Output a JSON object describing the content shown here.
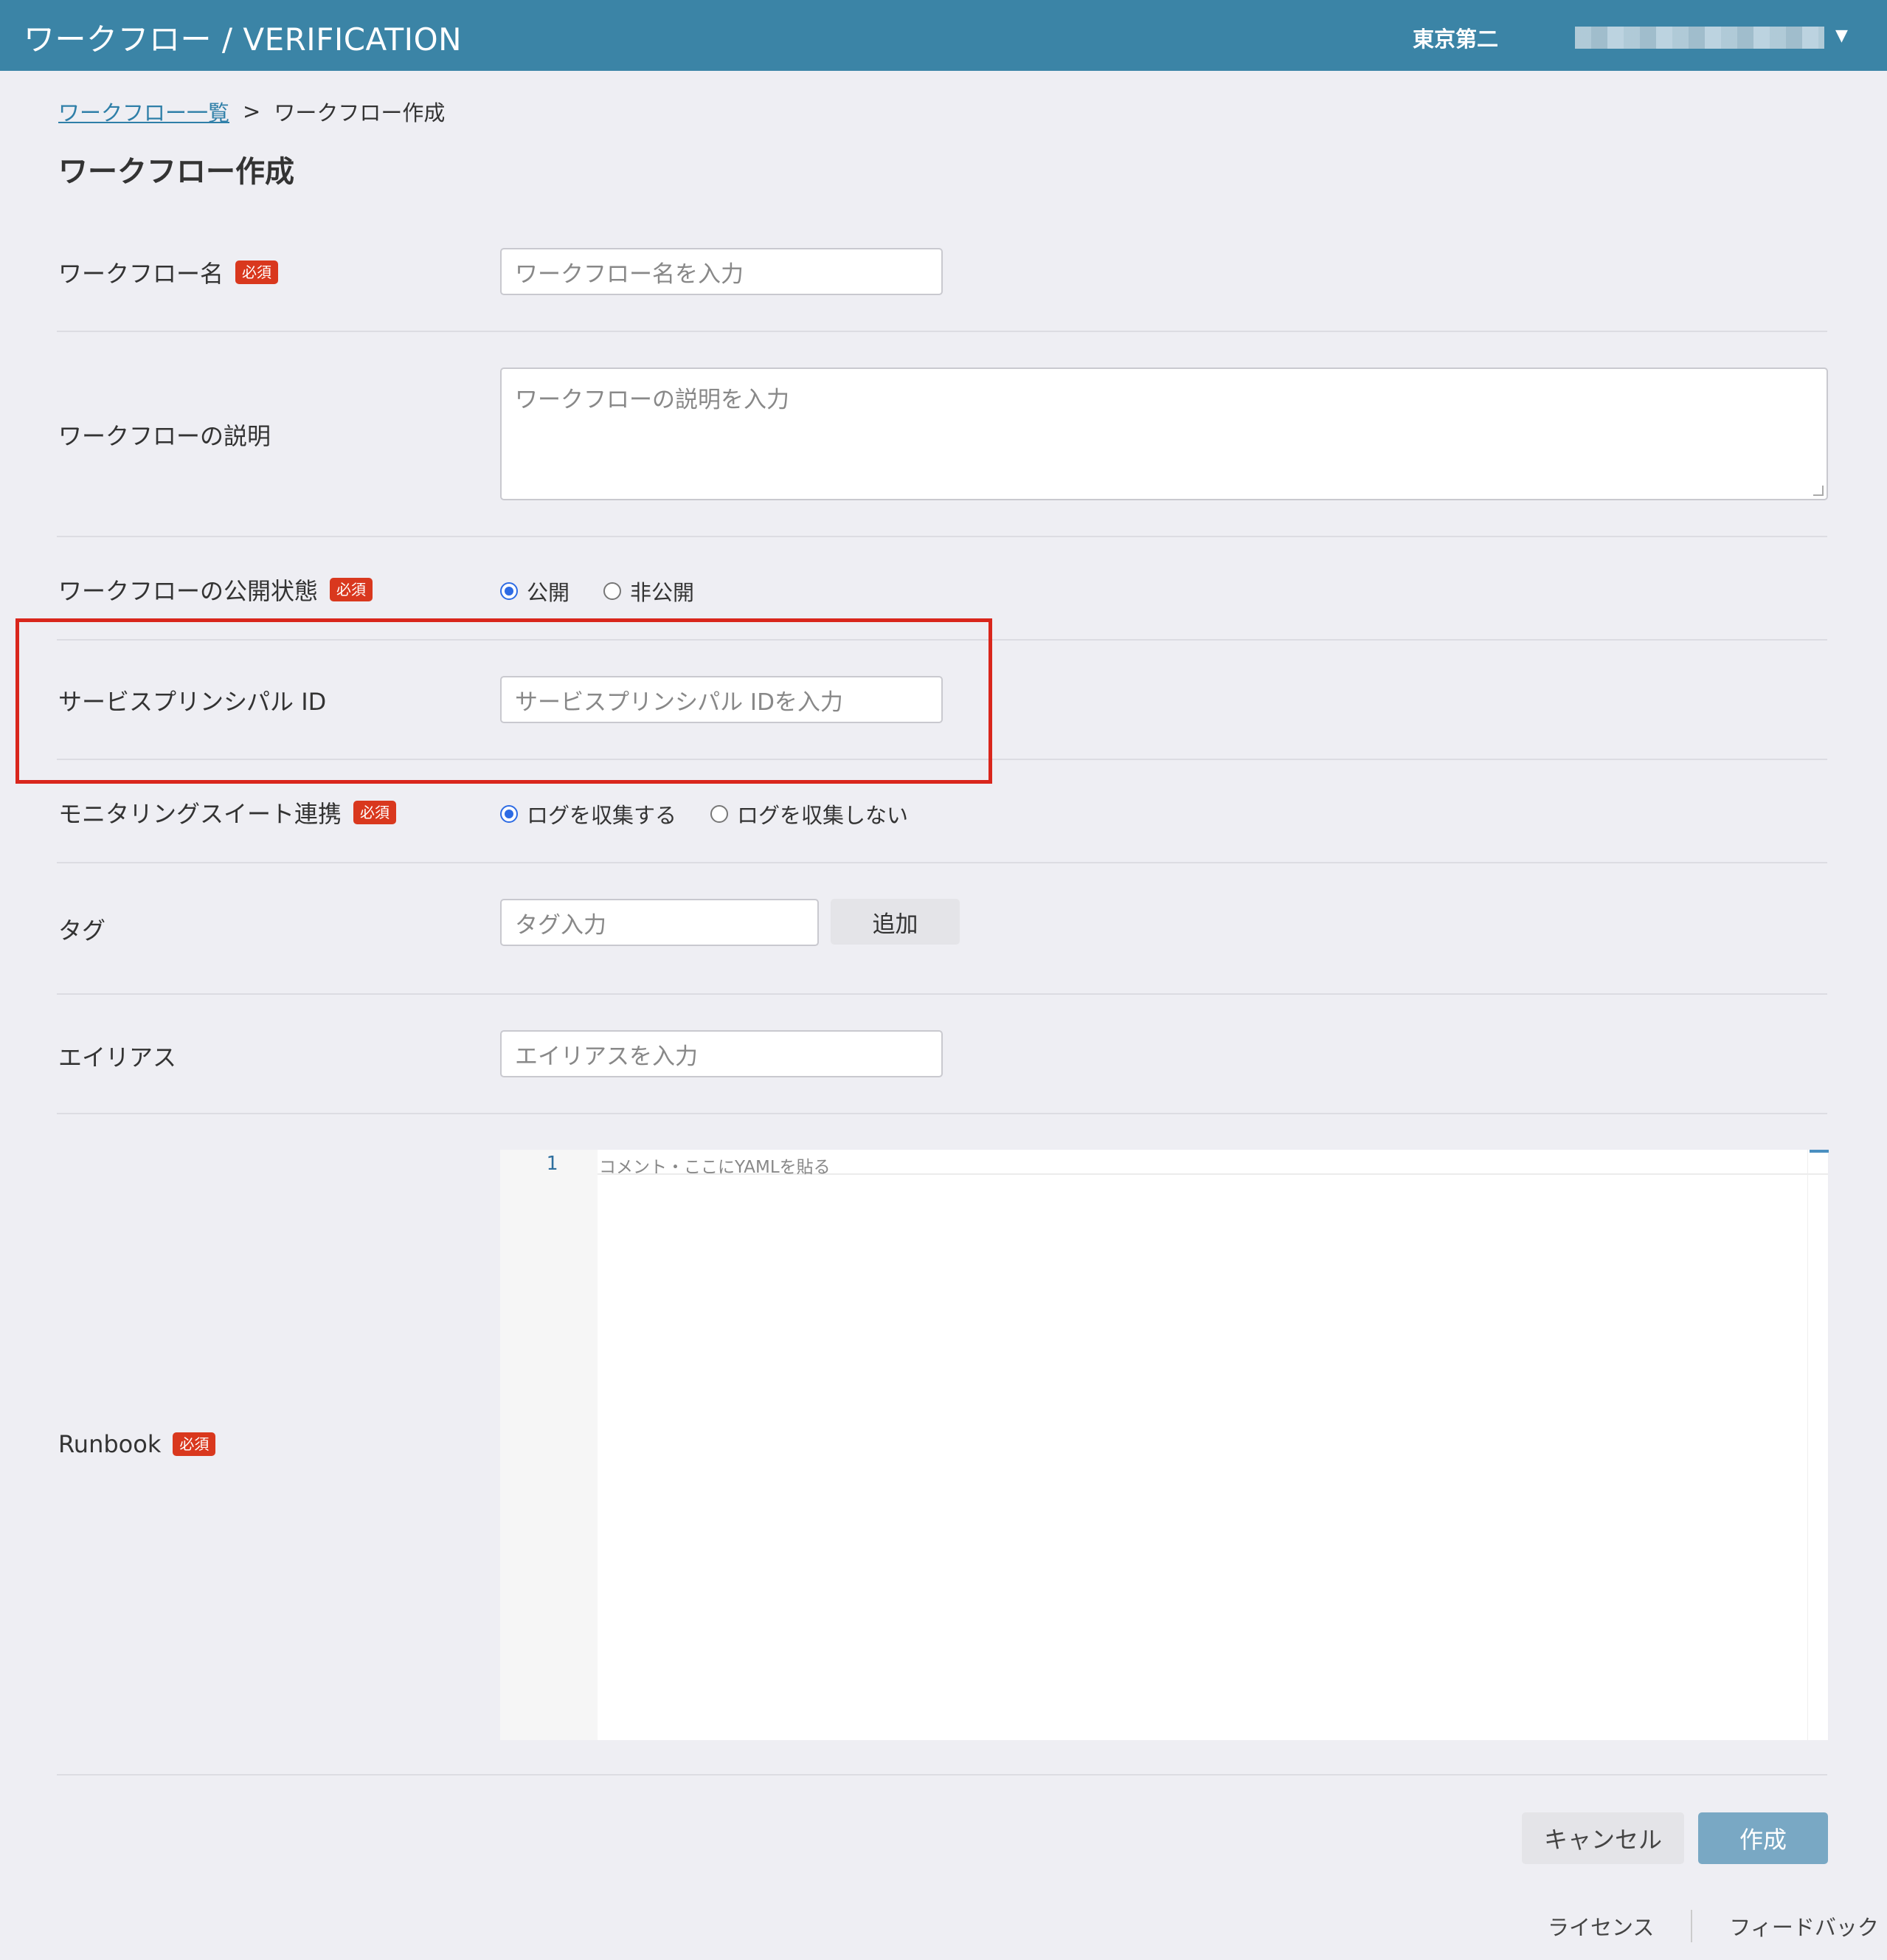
{
  "header": {
    "title": "ワークフロー / VERIFICATION",
    "region": "東京第二"
  },
  "breadcrumb": {
    "parent": "ワークフロー一覧",
    "separator": ">",
    "current": "ワークフロー作成"
  },
  "page_title": "ワークフロー作成",
  "required_badge": "必須",
  "fields": {
    "name": {
      "label": "ワークフロー名",
      "placeholder": "ワークフロー名を入力"
    },
    "description": {
      "label": "ワークフローの説明",
      "placeholder": "ワークフローの説明を入力"
    },
    "visibility": {
      "label": "ワークフローの公開状態",
      "options": [
        "公開",
        "非公開"
      ],
      "selected": "公開"
    },
    "service_principal": {
      "label": "サービスプリンシパル ID",
      "placeholder": "サービスプリンシパル IDを入力"
    },
    "monitoring": {
      "label": "モニタリングスイート連携",
      "options": [
        "ログを収集する",
        "ログを収集しない"
      ],
      "selected": "ログを収集する"
    },
    "tags": {
      "label": "タグ",
      "placeholder": "タグ入力",
      "add_button": "追加"
    },
    "alias": {
      "label": "エイリアス",
      "placeholder": "エイリアスを入力"
    },
    "runbook": {
      "label": "Runbook",
      "line_number": "1",
      "placeholder": "コメント・ここにYAMLを貼る"
    }
  },
  "actions": {
    "cancel": "キャンセル",
    "create": "作成"
  },
  "footer": {
    "license": "ライセンス",
    "feedback": "フィードバック"
  },
  "colors": {
    "header": "#3b84a6",
    "required": "#d9381e",
    "highlight": "#d9261c",
    "primary_button": "#79a8c4"
  }
}
